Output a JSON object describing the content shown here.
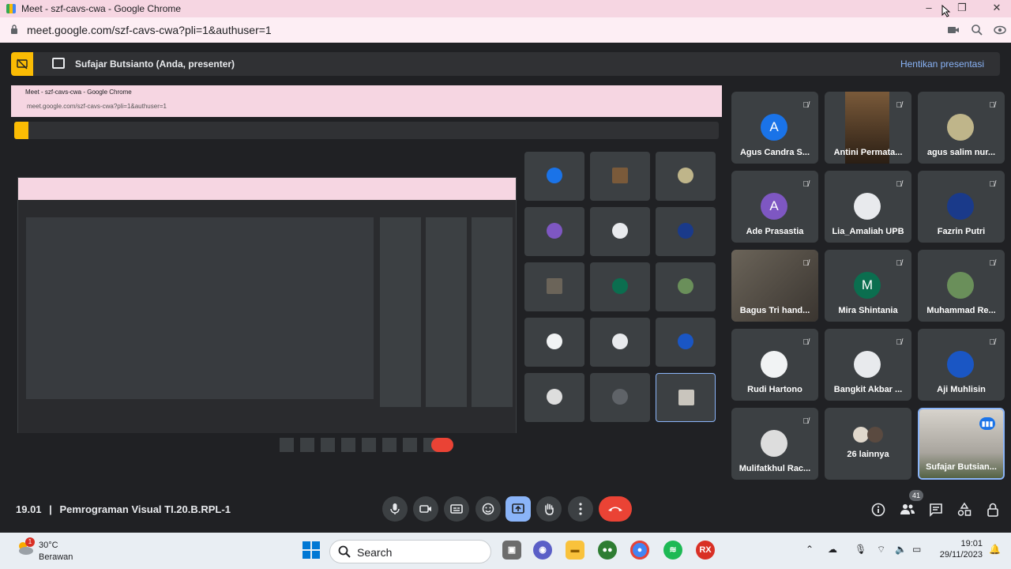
{
  "browser": {
    "title": "Meet - szf-cavs-cwa - Google Chrome",
    "url": "meet.google.com/szf-cavs-cwa?pli=1&authuser=1"
  },
  "banner": {
    "presenter": "Sufajar Butsianto (Anda, presenter)",
    "stop_label": "Hentikan presentasi"
  },
  "shared_screen": {
    "title": "Meet - szf-cavs-cwa - Google Chrome",
    "url": "meet.google.com/szf-cavs-cwa?pli=1&authuser=1"
  },
  "participants": [
    {
      "name": "Agus Candra S...",
      "initial": "A",
      "color": "#1a73e8",
      "type": "avatar"
    },
    {
      "name": "Antini Permata...",
      "initial": "",
      "color": "",
      "type": "photo"
    },
    {
      "name": "agus salim nur...",
      "initial": "",
      "color": "#bfb58a",
      "type": "avatar"
    },
    {
      "name": "Ade Prasastia",
      "initial": "A",
      "color": "#7e57c2",
      "type": "avatar"
    },
    {
      "name": "Lia_Amaliah UPB",
      "initial": "",
      "color": "#e8eaed",
      "type": "avatar"
    },
    {
      "name": "Fazrin Putri",
      "initial": "",
      "color": "#1a3a8a",
      "type": "avatar"
    },
    {
      "name": "Bagus Tri hand...",
      "initial": "",
      "color": "",
      "type": "photo2"
    },
    {
      "name": "Mira Shintania",
      "initial": "M",
      "color": "#0b6e4f",
      "type": "avatar"
    },
    {
      "name": "Muhammad Re...",
      "initial": "",
      "color": "#6a8f5a",
      "type": "avatar"
    },
    {
      "name": "Rudi Hartono",
      "initial": "",
      "color": "#f1f3f4",
      "type": "avatar"
    },
    {
      "name": "Bangkit Akbar ...",
      "initial": "",
      "color": "#e8eaed",
      "type": "avatar"
    },
    {
      "name": "Aji Muhlisin",
      "initial": "",
      "color": "#1a56c4",
      "type": "avatar"
    },
    {
      "name": "Mulifatkhul Rac...",
      "initial": "",
      "color": "#ddd",
      "type": "avatar"
    },
    {
      "name": "26 lainnya",
      "initial": "",
      "color": "",
      "type": "others"
    },
    {
      "name": "Sufajar Butsian...",
      "initial": "",
      "color": "",
      "type": "active"
    }
  ],
  "meeting": {
    "time": "19.01",
    "separator": "|",
    "name": "Pemrograman Visual TI.20.B.RPL-1",
    "participant_count": "41"
  },
  "taskbar": {
    "temperature": "30°C",
    "condition": "Berawan",
    "weather_badge": "1",
    "search_placeholder": "Search",
    "time": "19:01",
    "date": "29/11/2023"
  }
}
